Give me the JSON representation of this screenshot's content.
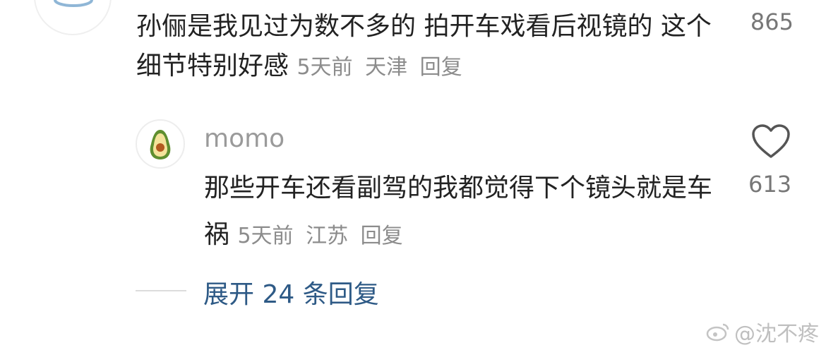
{
  "comment": {
    "text": "孙俪是我见过为数不多的 拍开车戏看后视镜的 这个细节特别好感",
    "time": "5天前",
    "location": "天津",
    "reply_label": "回复",
    "like_count": "865"
  },
  "reply": {
    "author": "momo",
    "text": "那些开车还看副驾的我都觉得下个镜头就是车祸",
    "time": "5天前",
    "location": "江苏",
    "reply_label": "回复",
    "like_count": "613"
  },
  "expand_label": "展开 24 条回复",
  "watermark": "@沈不疼",
  "icons": {
    "top_avatar": "planet-avatar-icon",
    "reply_avatar": "avocado-avatar-icon",
    "like": "heart-icon",
    "watermark_logo": "weibo-logo-icon"
  }
}
